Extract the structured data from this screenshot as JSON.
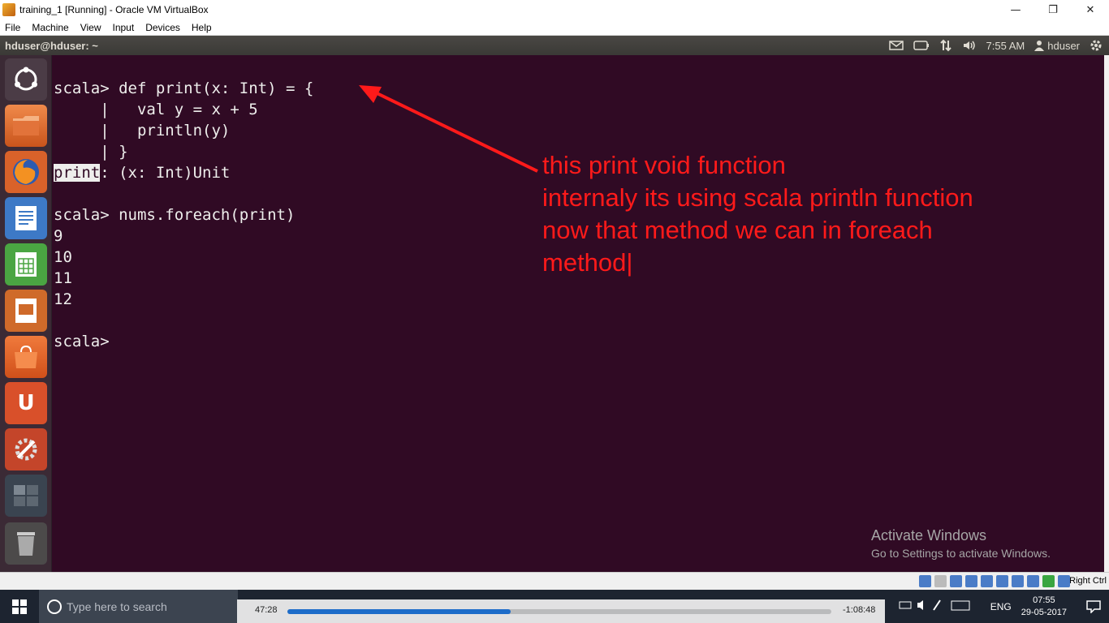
{
  "host_window": {
    "title": "training_1 [Running] - Oracle VM VirtualBox",
    "controls": {
      "minimize": "—",
      "restore": "❐",
      "close": "✕"
    }
  },
  "vbox_menu": [
    "File",
    "Machine",
    "View",
    "Input",
    "Devices",
    "Help"
  ],
  "ubuntu_panel": {
    "title": "hduser@hduser: ~",
    "time": "7:55 AM",
    "user": "hduser"
  },
  "terminal": {
    "lines": [
      "scala> def print(x: Int) = {",
      "     |   val y = x + 5",
      "     |   println(y)",
      "     | }",
      ": (x: Int)Unit",
      "",
      "scala> nums.foreach(print)",
      "9",
      "10",
      "11",
      "12",
      "",
      "scala>"
    ],
    "highlighted_word": "print"
  },
  "annotation": {
    "color": "#ff1a1a",
    "lines": [
      "this print void function",
      "internaly its using scala println function",
      "now that method we can in foreach",
      "method|"
    ]
  },
  "watermark": {
    "line1": "Activate Windows",
    "line2": "Go to Settings to activate Windows."
  },
  "vbox_status": {
    "host_key": "Right Ctrl"
  },
  "taskbar": {
    "search_placeholder": "Type here to search",
    "language": "ENG",
    "time": "07:55",
    "date": "29-05-2017"
  },
  "player": {
    "elapsed": "47:28",
    "remaining": "-1:08:48",
    "progress_percent": 41
  }
}
